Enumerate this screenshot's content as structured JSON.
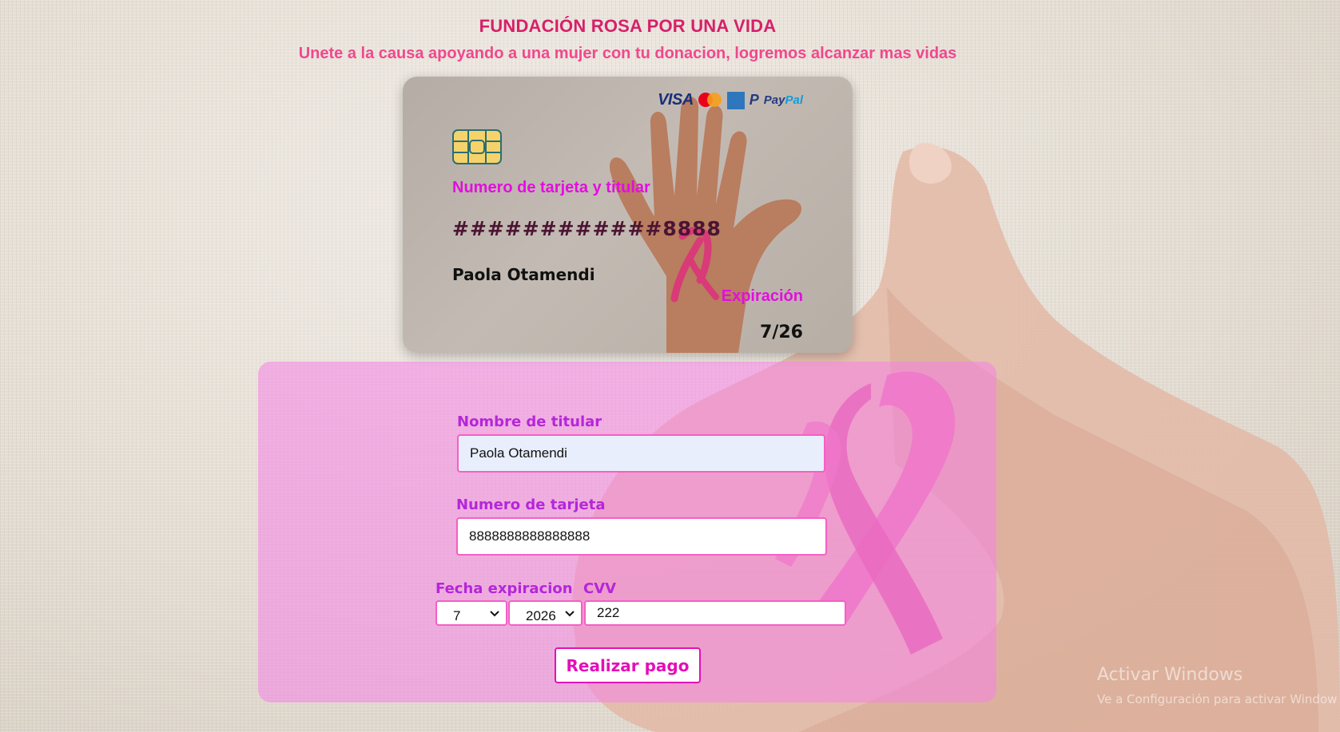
{
  "header": {
    "title": "FUNDACIÓN ROSA POR UNA VIDA",
    "subtitle": "Unete a la causa apoyando a una mujer con tu donacion, logremos alcanzar mas vidas"
  },
  "card": {
    "brands": {
      "visa": "VISA",
      "mastercard_icon": "mastercard-icon",
      "amex": "AMERICAN EXPRESS",
      "paypal_mark": "P",
      "paypal_pay": "Pay",
      "paypal_pal": "Pal"
    },
    "number_label": "Numero de tarjeta y titular",
    "number_masked": "############8888",
    "holder": "Paola Otamendi",
    "expiration_label": "Expiración",
    "expiration_value": "7/26"
  },
  "form": {
    "holder_label": "Nombre de titular",
    "holder_value": "Paola Otamendi",
    "number_label": "Numero de tarjeta",
    "number_value": "8888888888888888",
    "expiration_label": "Fecha expiracion",
    "month_value": "7",
    "year_value": "2026",
    "cvv_label": "CVV",
    "cvv_value": "222",
    "submit_label": "Realizar pago"
  },
  "system": {
    "watermark_title": "Activar Windows",
    "watermark_sub": "Ve a Configuración para activar Windows."
  },
  "colors": {
    "title": "#d6206a",
    "subtitle": "#f0488d",
    "accent_pink": "#e40de0",
    "label_purple": "#b526d9",
    "panel": "#f582e6"
  }
}
